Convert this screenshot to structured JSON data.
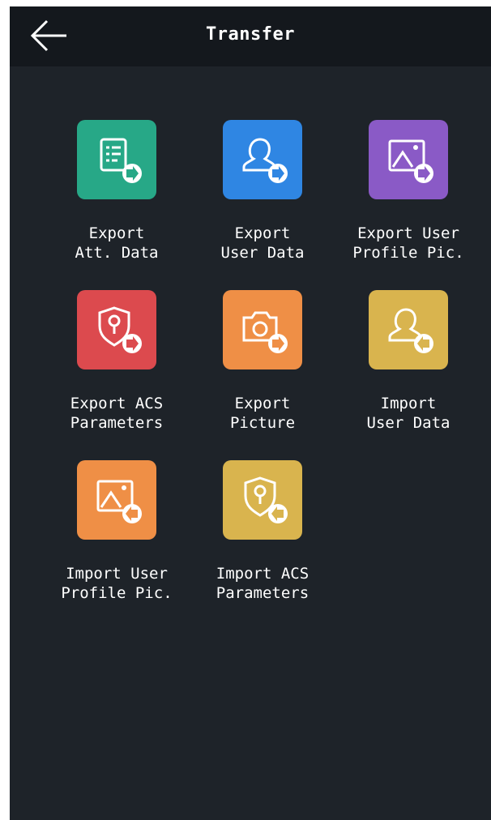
{
  "header": {
    "title": "Transfer",
    "back_icon": "arrow-left-icon"
  },
  "colors": {
    "background": "#1e2329",
    "header": "#14181d",
    "green": "#27a887",
    "blue": "#2f86e3",
    "purple": "#8a5ac6",
    "red": "#dc4a4e",
    "orange": "#ef8f46",
    "gold": "#d9b44e"
  },
  "items": [
    {
      "label": "Export\nAtt. Data",
      "icon": "attendance-export-icon"
    },
    {
      "label": "Export\nUser Data",
      "icon": "user-export-icon"
    },
    {
      "label": "Export User\nProfile Pic.",
      "icon": "picture-export-icon"
    },
    {
      "label": "Export ACS\nParameters",
      "icon": "acs-export-icon"
    },
    {
      "label": "Export\nPicture",
      "icon": "camera-export-icon"
    },
    {
      "label": "Import\nUser Data",
      "icon": "user-import-icon"
    },
    {
      "label": "Import User\nProfile Pic.",
      "icon": "picture-import-icon"
    },
    {
      "label": "Import ACS\nParameters",
      "icon": "acs-import-icon"
    }
  ]
}
